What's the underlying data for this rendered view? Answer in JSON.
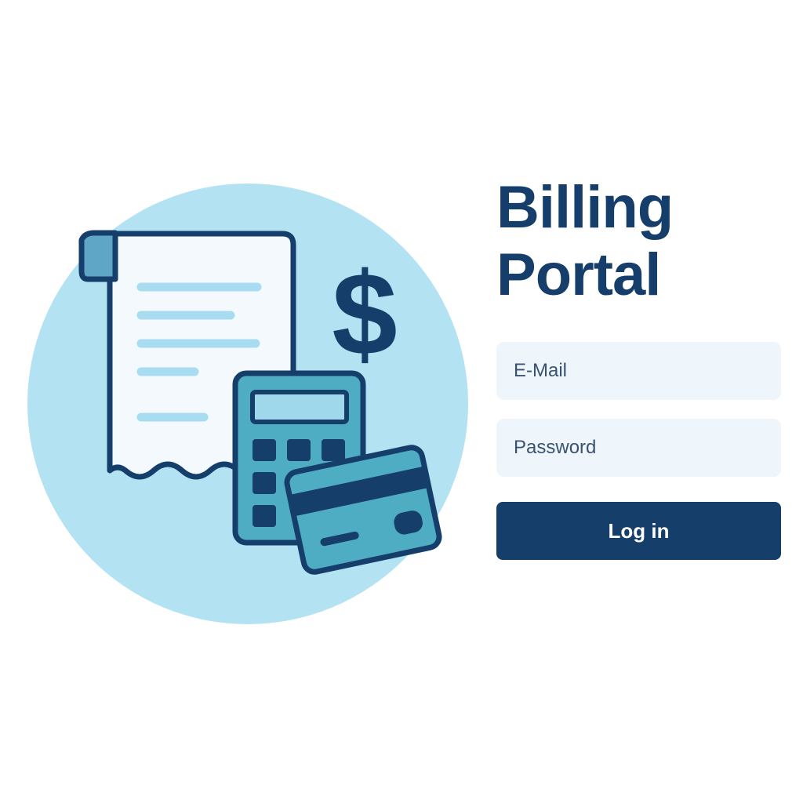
{
  "header": {
    "title_line1": "Billing",
    "title_line2": "Portal"
  },
  "form": {
    "email_placeholder": "E-Mail",
    "password_placeholder": "Password",
    "login_label": "Log in"
  },
  "illustration": {
    "dollar_sign": "$",
    "icons": [
      "receipt-icon",
      "dollar-sign-icon",
      "calculator-icon",
      "credit-card-icon"
    ]
  },
  "colors": {
    "primary": "#163e6b",
    "circle_background": "#b3e3f3",
    "field_background": "#eef5fb",
    "accent_teal": "#4fadc3",
    "line_light_blue": "#a8dcf0"
  }
}
